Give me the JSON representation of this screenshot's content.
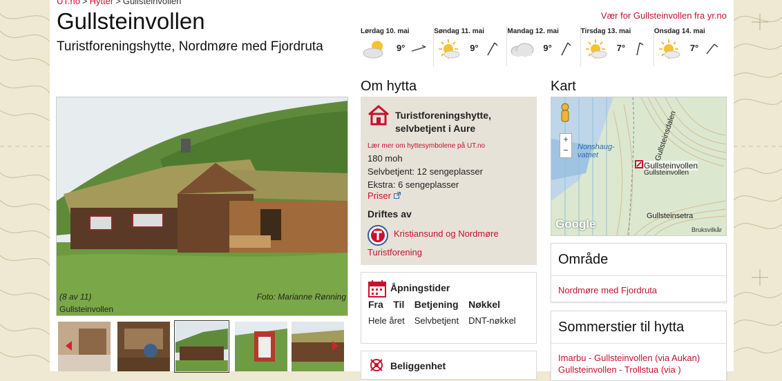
{
  "breadcrumb": [
    "UT.no",
    "Hytter",
    "Gullsteinvollen"
  ],
  "header": {
    "title": "Gullsteinvollen",
    "subtitle": "Turistforeningshytte, Nordmøre med Fjordruta"
  },
  "weather": {
    "link": "Vær for Gullsteinvollen fra yr.no",
    "days": [
      {
        "day": "Lørdag 10. mai",
        "temp": "9°",
        "icon": "partly-cloudy-icon"
      },
      {
        "day": "Søndag 11. mai",
        "temp": "9°",
        "icon": "sun-cloud-icon"
      },
      {
        "day": "Mandag 12. mai",
        "temp": "9°",
        "icon": "cloud-icon"
      },
      {
        "day": "Tirsdag 13. mai",
        "temp": "7°",
        "icon": "sun-cloud-icon"
      },
      {
        "day": "Onsdag 14. mai",
        "temp": "7°",
        "icon": "sun-cloud-icon"
      }
    ]
  },
  "gallery": {
    "counter": "(8 av 11)",
    "credit": "Foto: Marianne Rønning",
    "caption": "Gullsteinvollen"
  },
  "about": {
    "heading": "Om hytta",
    "type": "Turistforeningshytte, selvbetjent i Aure",
    "learn_link": "Lær mer om hyttesymbolene på UT.no",
    "facts": [
      "180 moh",
      "Selvbetjent: 12 sengeplasser",
      "Ekstra: 6 sengeplasser"
    ],
    "prices_link": "Priser",
    "operated_heading": "Driftes av",
    "operator_line1": "Kristiansund og Nordmøre",
    "operator_line2": "Turistforening"
  },
  "opening": {
    "heading": "Åpningstider",
    "columns": [
      "Fra",
      "Til",
      "Betjening",
      "Nøkkel"
    ],
    "row": [
      "Hele året",
      "",
      "Selvbetjent",
      "DNT-nøkkel"
    ]
  },
  "location": {
    "heading": "Beliggenhet"
  },
  "map": {
    "heading": "Kart",
    "marker_label": "Gullsteinvollen",
    "labels": [
      "Gullsteinsdalen",
      "Gullsteinvollen",
      "Gullsteinsetra",
      "Nonshaug-",
      "vatnet"
    ],
    "zoom_in": "+",
    "zoom_out": "−",
    "logo": "Google",
    "terms": "Bruksvilkår"
  },
  "area": {
    "heading": "Område",
    "link": "Nordmøre med Fjordruta"
  },
  "trails": {
    "heading": "Sommerstier til hytta",
    "links": [
      "Imarbu - Gullsteinvollen (via Aukan)",
      "Gullsteinvollen - Trollstua (via )"
    ]
  },
  "colors": {
    "accent": "#c8102e",
    "box_bg": "#e6e2d8",
    "page_bg": "#efe8d2"
  }
}
